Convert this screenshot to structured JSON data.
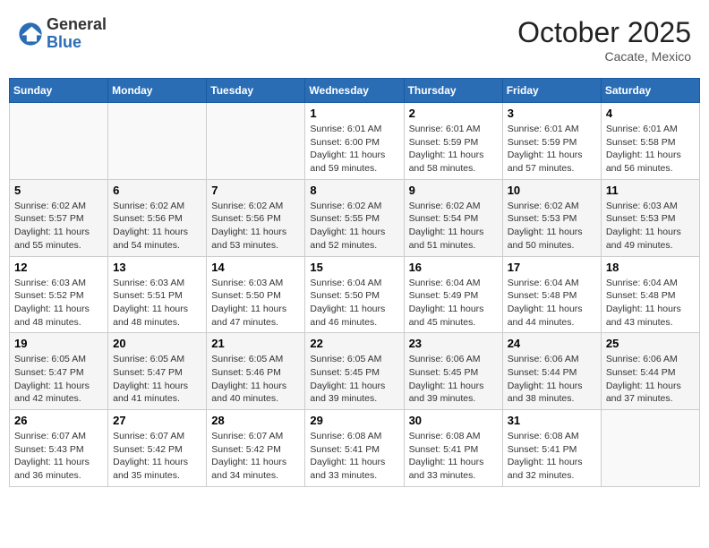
{
  "header": {
    "logo_general": "General",
    "logo_blue": "Blue",
    "month_title": "October 2025",
    "location": "Cacate, Mexico"
  },
  "weekdays": [
    "Sunday",
    "Monday",
    "Tuesday",
    "Wednesday",
    "Thursday",
    "Friday",
    "Saturday"
  ],
  "weeks": [
    {
      "days": [
        {
          "num": "",
          "info": ""
        },
        {
          "num": "",
          "info": ""
        },
        {
          "num": "",
          "info": ""
        },
        {
          "num": "1",
          "info": "Sunrise: 6:01 AM\nSunset: 6:00 PM\nDaylight: 11 hours and 59 minutes."
        },
        {
          "num": "2",
          "info": "Sunrise: 6:01 AM\nSunset: 5:59 PM\nDaylight: 11 hours and 58 minutes."
        },
        {
          "num": "3",
          "info": "Sunrise: 6:01 AM\nSunset: 5:59 PM\nDaylight: 11 hours and 57 minutes."
        },
        {
          "num": "4",
          "info": "Sunrise: 6:01 AM\nSunset: 5:58 PM\nDaylight: 11 hours and 56 minutes."
        }
      ]
    },
    {
      "days": [
        {
          "num": "5",
          "info": "Sunrise: 6:02 AM\nSunset: 5:57 PM\nDaylight: 11 hours and 55 minutes."
        },
        {
          "num": "6",
          "info": "Sunrise: 6:02 AM\nSunset: 5:56 PM\nDaylight: 11 hours and 54 minutes."
        },
        {
          "num": "7",
          "info": "Sunrise: 6:02 AM\nSunset: 5:56 PM\nDaylight: 11 hours and 53 minutes."
        },
        {
          "num": "8",
          "info": "Sunrise: 6:02 AM\nSunset: 5:55 PM\nDaylight: 11 hours and 52 minutes."
        },
        {
          "num": "9",
          "info": "Sunrise: 6:02 AM\nSunset: 5:54 PM\nDaylight: 11 hours and 51 minutes."
        },
        {
          "num": "10",
          "info": "Sunrise: 6:02 AM\nSunset: 5:53 PM\nDaylight: 11 hours and 50 minutes."
        },
        {
          "num": "11",
          "info": "Sunrise: 6:03 AM\nSunset: 5:53 PM\nDaylight: 11 hours and 49 minutes."
        }
      ]
    },
    {
      "days": [
        {
          "num": "12",
          "info": "Sunrise: 6:03 AM\nSunset: 5:52 PM\nDaylight: 11 hours and 48 minutes."
        },
        {
          "num": "13",
          "info": "Sunrise: 6:03 AM\nSunset: 5:51 PM\nDaylight: 11 hours and 48 minutes."
        },
        {
          "num": "14",
          "info": "Sunrise: 6:03 AM\nSunset: 5:50 PM\nDaylight: 11 hours and 47 minutes."
        },
        {
          "num": "15",
          "info": "Sunrise: 6:04 AM\nSunset: 5:50 PM\nDaylight: 11 hours and 46 minutes."
        },
        {
          "num": "16",
          "info": "Sunrise: 6:04 AM\nSunset: 5:49 PM\nDaylight: 11 hours and 45 minutes."
        },
        {
          "num": "17",
          "info": "Sunrise: 6:04 AM\nSunset: 5:48 PM\nDaylight: 11 hours and 44 minutes."
        },
        {
          "num": "18",
          "info": "Sunrise: 6:04 AM\nSunset: 5:48 PM\nDaylight: 11 hours and 43 minutes."
        }
      ]
    },
    {
      "days": [
        {
          "num": "19",
          "info": "Sunrise: 6:05 AM\nSunset: 5:47 PM\nDaylight: 11 hours and 42 minutes."
        },
        {
          "num": "20",
          "info": "Sunrise: 6:05 AM\nSunset: 5:47 PM\nDaylight: 11 hours and 41 minutes."
        },
        {
          "num": "21",
          "info": "Sunrise: 6:05 AM\nSunset: 5:46 PM\nDaylight: 11 hours and 40 minutes."
        },
        {
          "num": "22",
          "info": "Sunrise: 6:05 AM\nSunset: 5:45 PM\nDaylight: 11 hours and 39 minutes."
        },
        {
          "num": "23",
          "info": "Sunrise: 6:06 AM\nSunset: 5:45 PM\nDaylight: 11 hours and 39 minutes."
        },
        {
          "num": "24",
          "info": "Sunrise: 6:06 AM\nSunset: 5:44 PM\nDaylight: 11 hours and 38 minutes."
        },
        {
          "num": "25",
          "info": "Sunrise: 6:06 AM\nSunset: 5:44 PM\nDaylight: 11 hours and 37 minutes."
        }
      ]
    },
    {
      "days": [
        {
          "num": "26",
          "info": "Sunrise: 6:07 AM\nSunset: 5:43 PM\nDaylight: 11 hours and 36 minutes."
        },
        {
          "num": "27",
          "info": "Sunrise: 6:07 AM\nSunset: 5:42 PM\nDaylight: 11 hours and 35 minutes."
        },
        {
          "num": "28",
          "info": "Sunrise: 6:07 AM\nSunset: 5:42 PM\nDaylight: 11 hours and 34 minutes."
        },
        {
          "num": "29",
          "info": "Sunrise: 6:08 AM\nSunset: 5:41 PM\nDaylight: 11 hours and 33 minutes."
        },
        {
          "num": "30",
          "info": "Sunrise: 6:08 AM\nSunset: 5:41 PM\nDaylight: 11 hours and 33 minutes."
        },
        {
          "num": "31",
          "info": "Sunrise: 6:08 AM\nSunset: 5:41 PM\nDaylight: 11 hours and 32 minutes."
        },
        {
          "num": "",
          "info": ""
        }
      ]
    }
  ]
}
